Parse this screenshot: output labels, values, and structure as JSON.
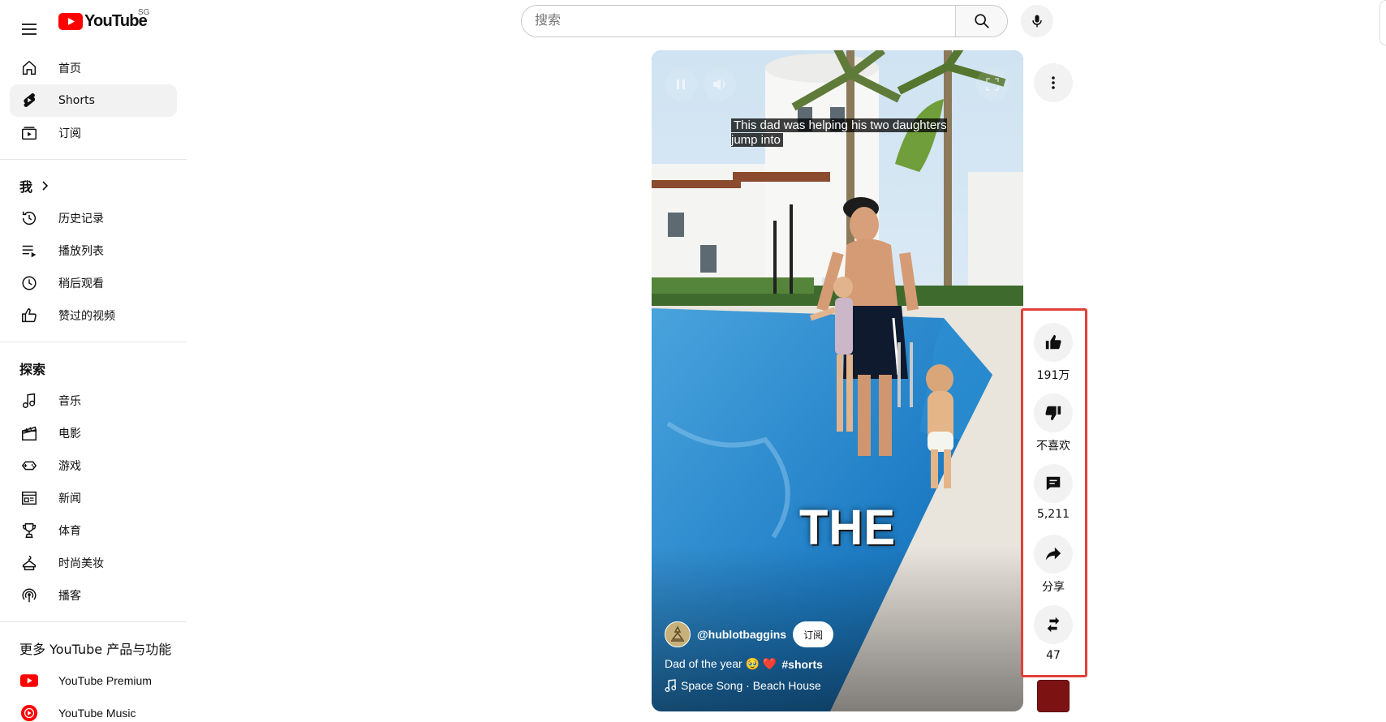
{
  "header": {
    "logo_text": "YouTube",
    "region": "SG",
    "search_placeholder": "搜索"
  },
  "sidebar": {
    "main": [
      {
        "label": "首页",
        "icon": "home-icon"
      },
      {
        "label": "Shorts",
        "icon": "shorts-icon",
        "active": true
      },
      {
        "label": "订阅",
        "icon": "subscriptions-icon"
      }
    ],
    "you": {
      "title": "我",
      "items": [
        {
          "label": "历史记录",
          "icon": "history-icon"
        },
        {
          "label": "播放列表",
          "icon": "playlists-icon"
        },
        {
          "label": "稍后观看",
          "icon": "watch-later-icon"
        },
        {
          "label": "赞过的视频",
          "icon": "liked-videos-icon"
        }
      ]
    },
    "explore": {
      "title": "探索",
      "items": [
        {
          "label": "音乐",
          "icon": "music-icon"
        },
        {
          "label": "电影",
          "icon": "movies-icon"
        },
        {
          "label": "游戏",
          "icon": "gaming-icon"
        },
        {
          "label": "新闻",
          "icon": "news-icon"
        },
        {
          "label": "体育",
          "icon": "sports-icon"
        },
        {
          "label": "时尚美妆",
          "icon": "fashion-icon"
        },
        {
          "label": "播客",
          "icon": "podcasts-icon"
        }
      ]
    },
    "more": {
      "title": "更多 YouTube 产品与功能",
      "items": [
        {
          "label": "YouTube Premium",
          "icon": "youtube-premium-icon"
        },
        {
          "label": "YouTube Music",
          "icon": "youtube-music-icon"
        }
      ]
    }
  },
  "short": {
    "caption": "This dad was helping his two daughters jump into",
    "overlay_text": "THE",
    "channel": "@hublotbaggins",
    "subscribe_label": "订阅",
    "title": "Dad of the year 🥹 ❤️",
    "hashtag": "#shorts",
    "sound": "Space Song · Beach House"
  },
  "actions": {
    "like_count": "191万",
    "dislike_label": "不喜欢",
    "comment_count": "5,211",
    "share_label": "分享",
    "remix_count": "47"
  },
  "colors": {
    "brand_red": "#ff0000",
    "highlight_border": "#e0413a",
    "active_bg": "#f2f2f2"
  }
}
